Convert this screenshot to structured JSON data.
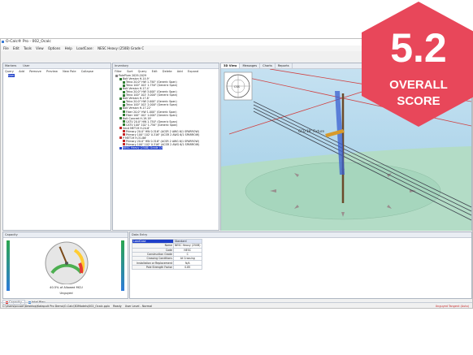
{
  "badge": {
    "score": "5.2",
    "line1": "OVERALL",
    "line2": "SCORE",
    "color": "#e8475a"
  },
  "app": {
    "title": "O-Calc® Pro - 002_Ocalc"
  },
  "menu": [
    "File",
    "Edit",
    "Tools",
    "View",
    "Options",
    "Help",
    "LoadCase:",
    "NESC Heavy (250B) Grade C"
  ],
  "left_panel": {
    "title": "Markers",
    "col2": "User",
    "toolbar": [
      "Query",
      "Add",
      "Remove",
      "Preview",
      "New Pole",
      "Collapse"
    ],
    "items": [
      "User"
    ]
  },
  "inventory": {
    "title": "Inventory",
    "toolbar": [
      "Filter",
      "Sort",
      "Query",
      "Edit",
      "Delete",
      "Add",
      "Expand"
    ],
    "items": [
      "PolePlum 2029-2029",
      "Bolt Version H-14.9'",
      "Telco 20.0\" HW 1.750\" (Generic Span)",
      "Telco 100\" 102' 1.750\" (Generic Span)",
      "Bolt Version H-17.4'",
      "Telco 20.0\" HW 3.000\" (Generic Span)",
      "Telco 100\" 102' 3.000\" (Generic Span)",
      "Bolt Version H-17.8'",
      "Telco 20.0\" HW 2.000\" (Generic Span)",
      "Telco 100\" 102' 2.000\" (Generic Span)",
      "Bolt Version H-17.22'",
      "Fiber 20.0\" HW 1.000\" (Generic Span)",
      "Fiber 100\" 102' 1.000\" (Generic Span)",
      "Bolt Concret H-19.19'",
      "CATV 20.0\" HW 1.750\" (Generic Span)",
      "CATV 100\" 102' 1.750\" (Generic Span)",
      "Secd MET19 H-24.6'",
      "Primary 20.0\" HW 0.316\" (ACSR 2 AWG 6/1 SPARROW)",
      "Primary 100\" 102' 0.316\" (ACSR 2 AWG 6/1 SPARROW)",
      "P MET19 H-31.86'",
      "Primary 20.0\" HW 0.316\" (ACSR 2 AWG 6/1 SPARROW)",
      "Primary 100\" 102' 0.316\" (ACSR 2 AWG 6/1 SPARROW)",
      "NESC Heavy (250B) Grade CV"
    ]
  },
  "view_tabs": [
    "3D View",
    "Messages",
    "Charts",
    "Reports"
  ],
  "view3d": {
    "label": "GCU 19\" Fixture",
    "compass": "CSS"
  },
  "capacity": {
    "title": "Capacity",
    "label": "40.5% of Allowed MCU",
    "status": "Unguyed",
    "value": 40.5
  },
  "data_entry": {
    "title": "Data Entry",
    "header_left": "LoadCase",
    "header_right": "Standard",
    "rows": [
      [
        "Name",
        "NESC Heavy (250B)"
      ],
      [
        "Code",
        "NESC"
      ],
      [
        "Construction Grade",
        "C"
      ],
      [
        "Crossing Conditions",
        "At Crossing"
      ],
      [
        "Installation or Replacement",
        "N/A"
      ],
      [
        "Pole Strength Factor",
        "0.85"
      ]
    ]
  },
  "bottom_tabs": [
    "Capacity",
    "Intel Plan"
  ],
  "status": {
    "path": "C:\\Users\\ocuser\\Desktop\\Katapult Pro Demo\\O-Calc\\3DModels\\002_Ocalc.pplx",
    "ready": "Ready",
    "user_level": "User Level - Normal",
    "right": "Unguyed Tangent (Auto)"
  }
}
